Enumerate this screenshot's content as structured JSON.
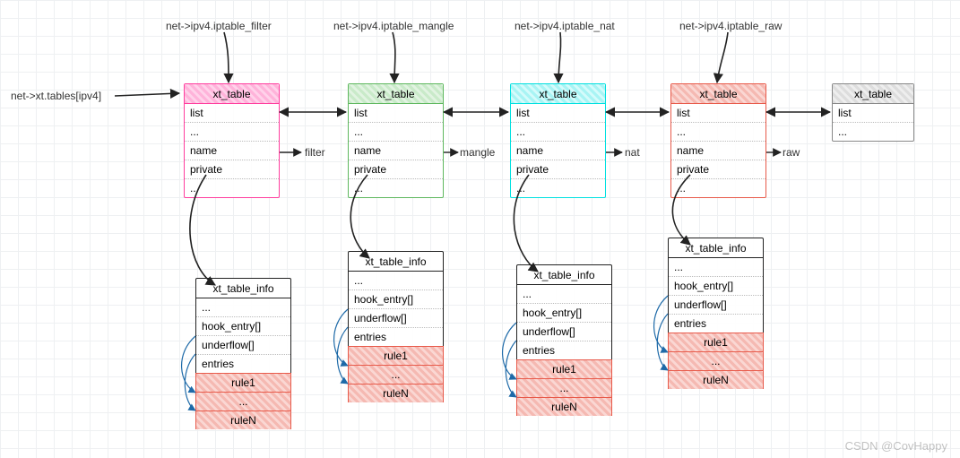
{
  "top_labels": {
    "filter": "net->ipv4.iptable_filter",
    "mangle": "net->ipv4.iptable_mangle",
    "nat": "net->ipv4.iptable_nat",
    "raw": "net->ipv4.iptable_raw"
  },
  "side_label": "net->xt.tables[ipv4]",
  "xt_table": {
    "title": "xt_table",
    "rows": [
      "list",
      "...",
      "name",
      "private",
      "..."
    ]
  },
  "xt_table_short": {
    "title": "xt_table",
    "rows": [
      "list",
      "..."
    ]
  },
  "name_values": {
    "filter": "filter",
    "mangle": "mangle",
    "nat": "nat",
    "raw": "raw"
  },
  "info": {
    "title": "xt_table_info",
    "rows_pre": [
      "...",
      "hook_entry[]",
      "underflow[]",
      "entries"
    ],
    "rules": [
      "rule1",
      "...",
      "ruleN"
    ]
  },
  "watermark": "CSDN @CovHappy"
}
